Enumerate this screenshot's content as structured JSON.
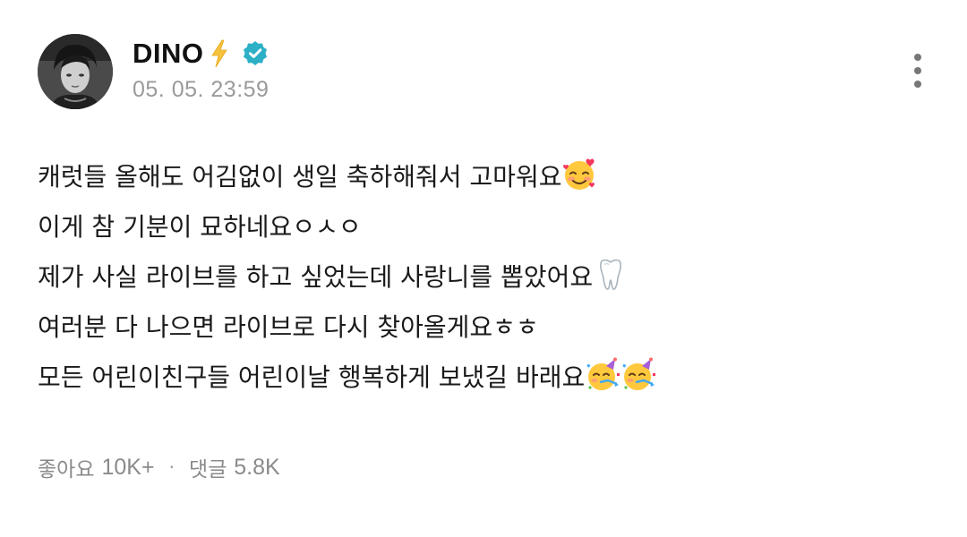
{
  "author": {
    "name": "DINO",
    "badge_icon": "lightning-icon",
    "verified_icon": "verified-icon",
    "verified_color": "#2bb0c6"
  },
  "post": {
    "time": "05. 05. 23:59",
    "lines": [
      {
        "text": "캐럿들 올해도 어김없이 생일 축하해줘서 고마워요",
        "emojis": [
          "smiling-face-with-hearts-icon"
        ]
      },
      {
        "text": "이게 참 기분이 묘하네요ㅇㅅㅇ",
        "emojis": []
      },
      {
        "text": "제가 사실 라이브를 하고 싶었는데 사랑니를 뽑았어요",
        "emojis": [
          "tooth-icon"
        ]
      },
      {
        "text": "여러분 다 나으면 라이브로 다시 찾아올게요ㅎㅎ",
        "emojis": []
      },
      {
        "text": "모든 어린이친구들 어린이날 행복하게 보냈길 바래요",
        "emojis": [
          "partying-face-icon",
          "partying-face-icon"
        ]
      }
    ]
  },
  "stats": {
    "likes_label": "좋아요",
    "likes_value": "10K+",
    "separator": "·",
    "comments_label": "댓글",
    "comments_value": "5.8K"
  },
  "colors": {
    "text": "#1a1a1a",
    "muted": "#9a9a9a",
    "lightning": "#f4b400"
  }
}
